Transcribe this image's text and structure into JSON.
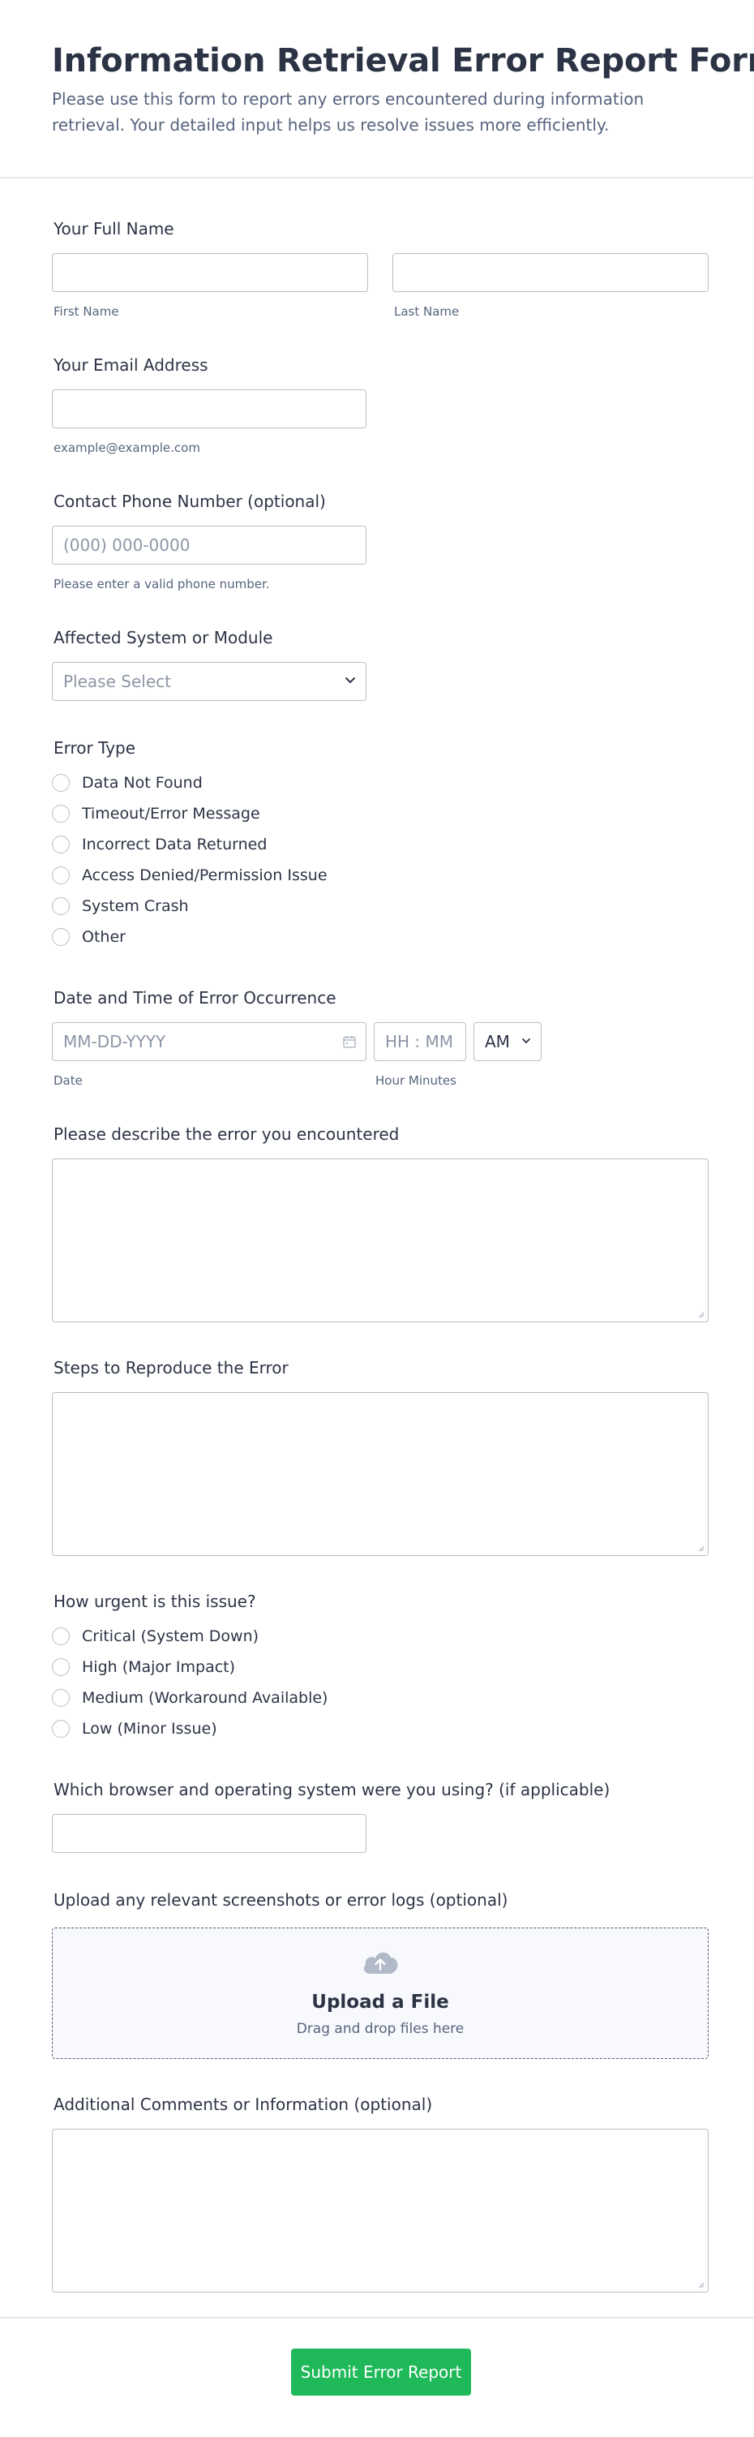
{
  "form": {
    "title": "Information Retrieval Error Report Form",
    "subtitle": "Please use this form to report any errors encountered during information retrieval. Your detailed input helps us resolve issues more efficiently."
  },
  "name": {
    "label": "Your Full Name",
    "first_sub": "First Name",
    "last_sub": "Last Name",
    "first_value": "",
    "last_value": ""
  },
  "email": {
    "label": "Your Email Address",
    "sub": "example@example.com",
    "value": ""
  },
  "phone": {
    "label": "Contact Phone Number (optional)",
    "placeholder": "(000) 000-0000",
    "sub": "Please enter a valid phone number."
  },
  "system": {
    "label": "Affected System or Module",
    "placeholder": "Please Select"
  },
  "error_type": {
    "label": "Error Type",
    "options": [
      "Data Not Found",
      "Timeout/Error Message",
      "Incorrect Data Returned",
      "Access Denied/Permission Issue",
      "System Crash",
      "Other"
    ]
  },
  "datetime": {
    "label": "Date and Time of Error Occurrence",
    "date_placeholder": "MM-DD-YYYY",
    "time_placeholder": "HH : MM",
    "ampm": "AM",
    "date_sub": "Date",
    "time_sub": "Hour Minutes"
  },
  "description": {
    "label": "Please describe the error you encountered"
  },
  "steps": {
    "label": "Steps to Reproduce the Error"
  },
  "urgency": {
    "label": "How urgent is this issue?",
    "options": [
      "Critical (System Down)",
      "High (Major Impact)",
      "Medium (Workaround Available)",
      "Low (Minor Issue)"
    ]
  },
  "browser": {
    "label": "Which browser and operating system were you using? (if applicable)"
  },
  "upload": {
    "label": "Upload any relevant screenshots or error logs (optional)",
    "title": "Upload a File",
    "subtitle": "Drag and drop files here"
  },
  "comments": {
    "label": "Additional Comments or Information (optional)"
  },
  "submit": {
    "label": "Submit Error Report"
  },
  "colors": {
    "submit_bg": "#1fb959",
    "text": "#2c3345",
    "muted": "#57647e",
    "border": "#b8bdc9",
    "upload_icon": "#b2b9c7"
  },
  "icons": {
    "date": "calendar-icon",
    "select": "chevron-down-icon",
    "upload": "cloud-upload-icon"
  }
}
